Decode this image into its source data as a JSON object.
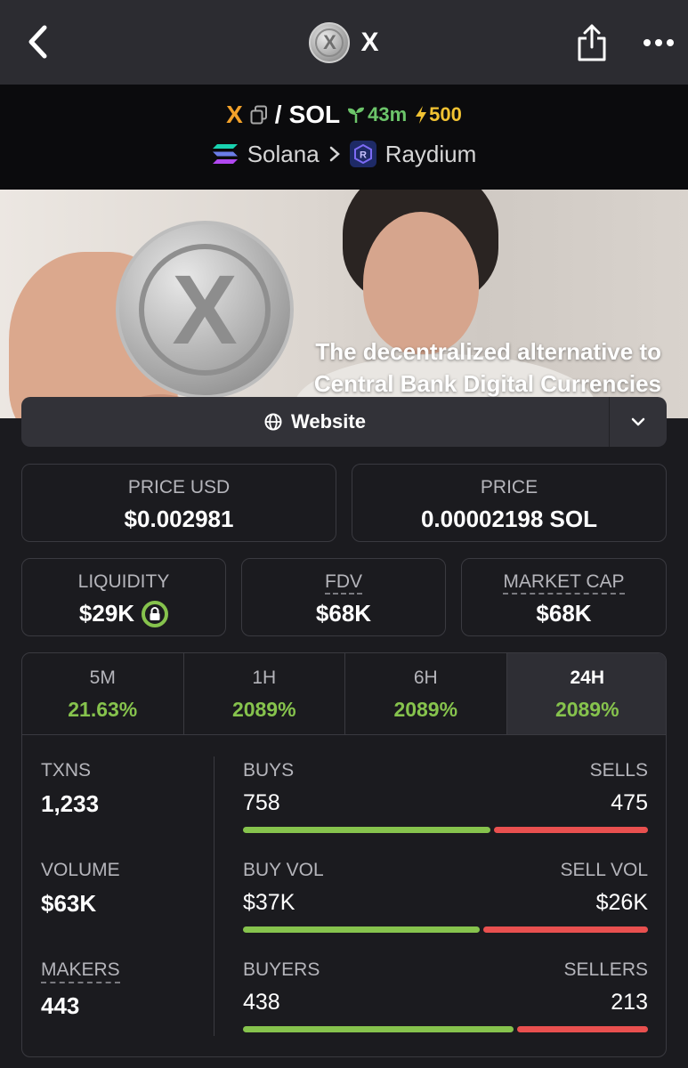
{
  "nav": {
    "title": "X",
    "coin_letter": "X"
  },
  "pair": {
    "base": "X",
    "slash": "/",
    "quote": "SOL",
    "age": "43m",
    "boost": "500",
    "chain": "Solana",
    "dex": "Raydium",
    "dex_letter": "R"
  },
  "banner": {
    "coin_letter": "X",
    "caption_line1": "The decentralized alternative to",
    "caption_line2": "Central Bank Digital Currencies"
  },
  "website": {
    "label": "Website"
  },
  "stats": {
    "price_usd": {
      "label": "PRICE USD",
      "value": "$0.002981"
    },
    "price": {
      "label": "PRICE",
      "value": "0.00002198 SOL"
    },
    "liquidity": {
      "label": "LIQUIDITY",
      "value": "$29K"
    },
    "fdv": {
      "label": "FDV",
      "value": "$68K"
    },
    "market_cap": {
      "label": "MARKET CAP",
      "value": "$68K"
    }
  },
  "tabs": [
    {
      "label": "5M",
      "pct": "21.63%"
    },
    {
      "label": "1H",
      "pct": "2089%"
    },
    {
      "label": "6H",
      "pct": "2089%"
    },
    {
      "label": "24H",
      "pct": "2089%",
      "active": true
    }
  ],
  "txns": {
    "label": "TXNS",
    "value": "1,233"
  },
  "volume": {
    "label": "VOLUME",
    "value": "$63K"
  },
  "makers": {
    "label": "MAKERS",
    "value": "443"
  },
  "splits": [
    {
      "left_label": "BUYS",
      "right_label": "SELLS",
      "left_value": "758",
      "right_value": "475",
      "buy_fraction": 0.615
    },
    {
      "left_label": "BUY VOL",
      "right_label": "SELL VOL",
      "left_value": "$37K",
      "right_value": "$26K",
      "buy_fraction": 0.59
    },
    {
      "left_label": "BUYERS",
      "right_label": "SELLERS",
      "left_value": "438",
      "right_value": "213",
      "buy_fraction": 0.673
    }
  ],
  "colors": {
    "accent_green": "#86c34d",
    "sell_red": "#e9504f",
    "base_orange": "#f2a12a",
    "boost_yellow": "#f1c232"
  }
}
